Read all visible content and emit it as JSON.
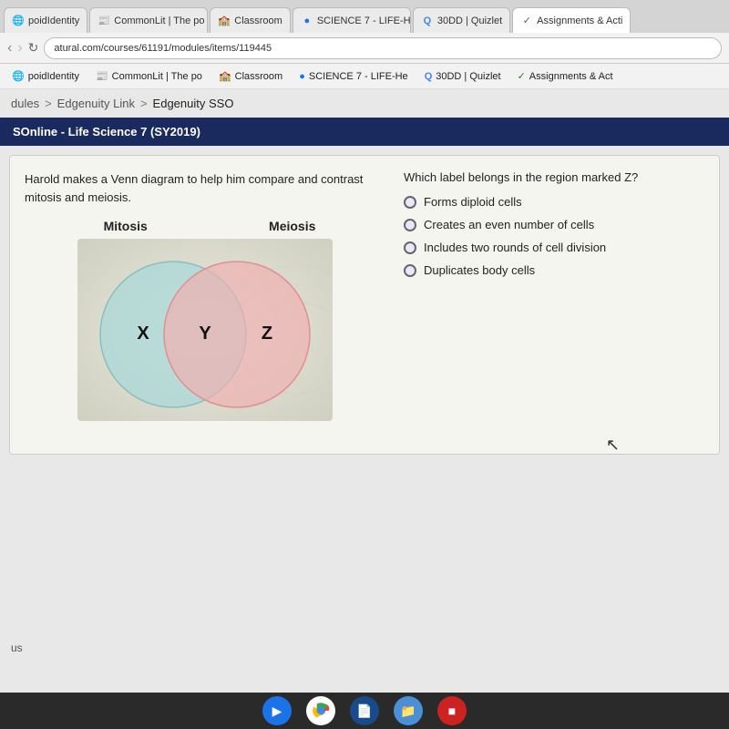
{
  "browser": {
    "address": "atural.com/courses/61191/modules/items/119445",
    "tabs": [
      {
        "id": "tab1",
        "label": "poidIdentity",
        "icon": "🌐",
        "active": false
      },
      {
        "id": "tab2",
        "label": "CommonLit | The po",
        "icon": "📄",
        "active": false
      },
      {
        "id": "tab3",
        "label": "Classroom",
        "icon": "🏫",
        "active": false
      },
      {
        "id": "tab4",
        "label": "SCIENCE 7 - LIFE-He",
        "icon": "🔵",
        "active": false
      },
      {
        "id": "tab5",
        "label": "30DD | Quizlet",
        "icon": "Q",
        "active": false
      },
      {
        "id": "tab6",
        "label": "Assignments & Acti",
        "icon": "✓",
        "active": true
      }
    ]
  },
  "bookmarks": [
    {
      "id": "bm1",
      "label": "poidIdentity"
    },
    {
      "id": "bm2",
      "label": "CommonLit | The po"
    },
    {
      "id": "bm3",
      "label": "Classroom"
    },
    {
      "id": "bm4",
      "label": "SCIENCE 7 - LIFE-He"
    },
    {
      "id": "bm5",
      "label": "30DD | Quizlet"
    },
    {
      "id": "bm6",
      "label": "Assignments & Act"
    }
  ],
  "breadcrumb": {
    "items": [
      "dules",
      "Edgenuity Link",
      "Edgenuity SSO"
    ],
    "separator": ">"
  },
  "course_header": {
    "title": "SOnline - Life Science 7 (SY2019)"
  },
  "question": {
    "stem": "Harold makes a Venn diagram to help him compare and contrast mitosis and meiosis.",
    "right_question": "Which label belongs in the region marked Z?",
    "venn": {
      "left_label": "Mitosis",
      "right_label": "Meiosis",
      "left_region": "X",
      "center_region": "Y",
      "right_region": "Z",
      "left_color": "#a8d8d8",
      "right_color": "#f0b8b8"
    },
    "options": [
      {
        "id": "opt1",
        "text": "Forms diploid cells"
      },
      {
        "id": "opt2",
        "text": "Creates an even number of cells"
      },
      {
        "id": "opt3",
        "text": "Includes two rounds of cell division"
      },
      {
        "id": "opt4",
        "text": "Duplicates body cells"
      }
    ]
  },
  "status": {
    "bottom_left": "us"
  },
  "taskbar": {
    "icons": [
      {
        "id": "ti1",
        "type": "blue",
        "symbol": "▶"
      },
      {
        "id": "ti2",
        "type": "multicolor",
        "symbol": "●"
      },
      {
        "id": "ti3",
        "type": "dark-blue",
        "symbol": "📄"
      },
      {
        "id": "ti4",
        "type": "folder",
        "symbol": "📁"
      },
      {
        "id": "ti5",
        "type": "red",
        "symbol": "■"
      }
    ]
  }
}
